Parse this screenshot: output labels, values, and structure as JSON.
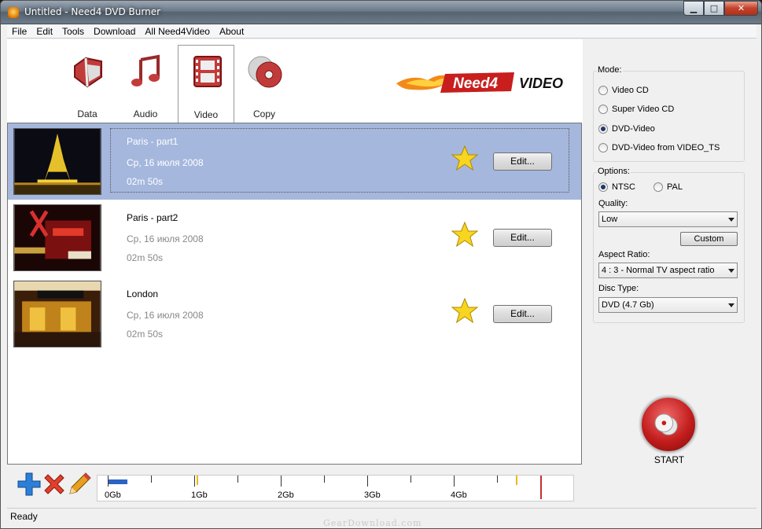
{
  "window": {
    "title": "Untitled - Need4 DVD Burner",
    "min": "▁",
    "max": "□",
    "close": "✕"
  },
  "menu": [
    "File",
    "Edit",
    "Tools",
    "Download",
    "All Need4Video",
    "About"
  ],
  "tabs": [
    {
      "label": "Data",
      "icon": "data-icon"
    },
    {
      "label": "Audio",
      "icon": "audio-icon"
    },
    {
      "label": "Video",
      "icon": "video-icon",
      "selected": true
    },
    {
      "label": "Copy",
      "icon": "copy-icon"
    }
  ],
  "logo": {
    "text_a": "Need4",
    "text_b": "VIDEO"
  },
  "items": [
    {
      "title": "Paris - part1",
      "date": "Ср, 16 июля 2008",
      "duration": "02m 50s",
      "edit": "Edit...",
      "selected": true
    },
    {
      "title": "Paris - part2",
      "date": "Ср, 16 июля 2008",
      "duration": "02m 50s",
      "edit": "Edit..."
    },
    {
      "title": "London",
      "date": "Ср, 16 июля 2008",
      "duration": "02m 50s",
      "edit": "Edit..."
    }
  ],
  "mode": {
    "label": "Mode:",
    "options": [
      "Video CD",
      "Super Video CD",
      "DVD-Video",
      "DVD-Video from VIDEO_TS"
    ],
    "selected": "DVD-Video"
  },
  "options": {
    "label": "Options:",
    "ntsc": "NTSC",
    "pal": "PAL",
    "quality_label": "Quality:",
    "quality": "Low",
    "custom": "Custom",
    "aspect_label": "Aspect Ratio:",
    "aspect": "4 : 3 - Normal TV aspect ratio",
    "disc_label": "Disc Type:",
    "disc": "DVD (4.7 Gb)"
  },
  "start": "START",
  "scale": {
    "labels": [
      "0Gb",
      "1Gb",
      "2Gb",
      "3Gb",
      "4Gb"
    ],
    "used_fraction": 0.045
  },
  "status": "Ready",
  "watermark": "GearDownload.com",
  "colors": {
    "accent": "#a5b7dd",
    "start": "#c31d1d"
  }
}
